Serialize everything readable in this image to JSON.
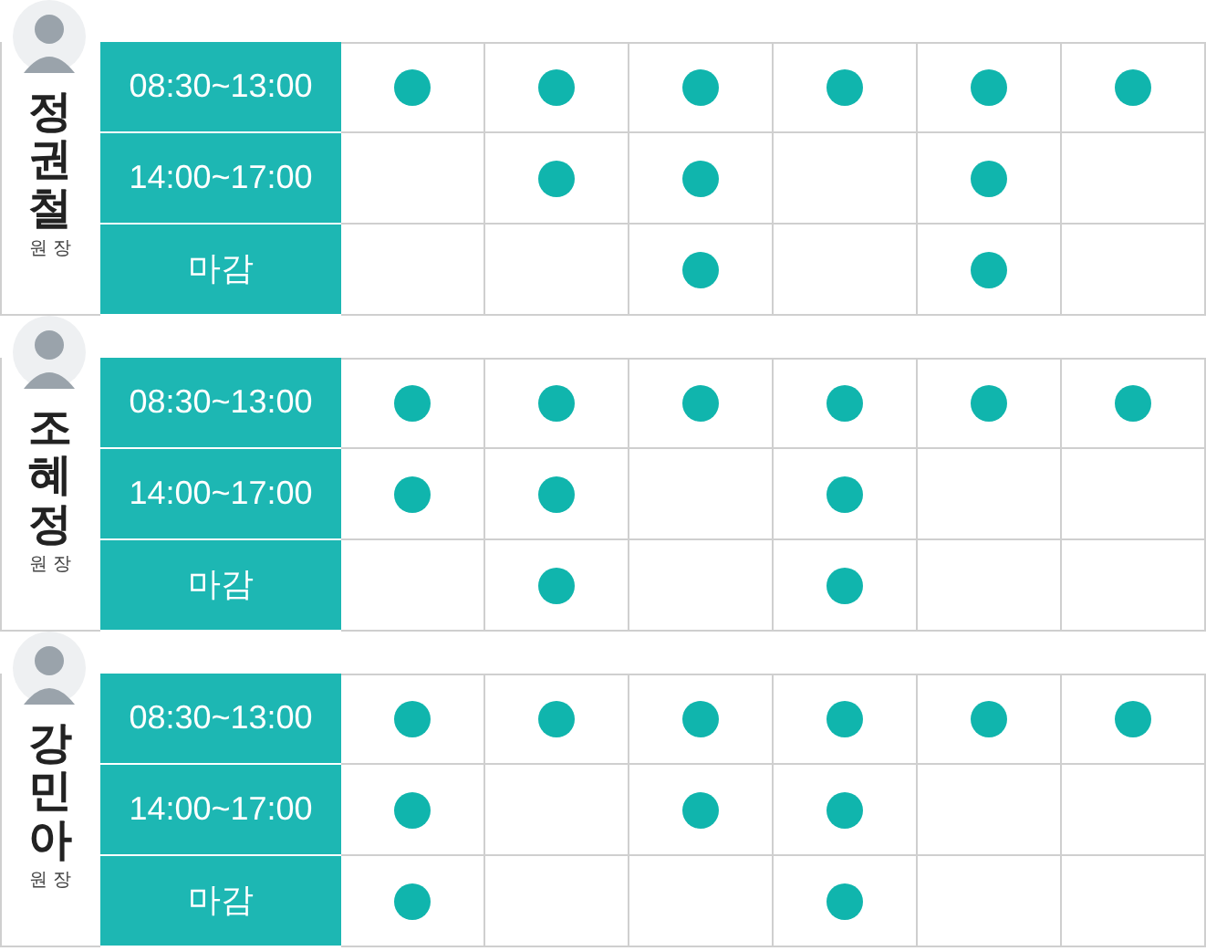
{
  "doctors": [
    {
      "name": "정권철",
      "title": "원장",
      "rows": [
        {
          "time": "08:30~13:00",
          "slots": [
            {
              "on": true
            },
            {
              "on": true
            },
            {
              "on": true
            },
            {
              "on": true
            },
            {
              "on": true
            },
            {
              "on": true
            }
          ]
        },
        {
          "time": "14:00~17:00",
          "slots": [
            {
              "on": false
            },
            {
              "on": true
            },
            {
              "on": true
            },
            {
              "on": false
            },
            {
              "on": true
            },
            {
              "on": false
            }
          ]
        },
        {
          "time": "마감",
          "slots": [
            {
              "on": false
            },
            {
              "on": false
            },
            {
              "on": true
            },
            {
              "on": false
            },
            {
              "on": true
            },
            {
              "on": false
            }
          ]
        }
      ]
    },
    {
      "name": "조혜정",
      "title": "원장",
      "rows": [
        {
          "time": "08:30~13:00",
          "slots": [
            {
              "on": true
            },
            {
              "on": true
            },
            {
              "on": true
            },
            {
              "on": true
            },
            {
              "on": true
            },
            {
              "on": true
            }
          ]
        },
        {
          "time": "14:00~17:00",
          "slots": [
            {
              "on": true
            },
            {
              "on": true
            },
            {
              "on": false
            },
            {
              "on": true
            },
            {
              "on": false
            },
            {
              "on": false
            }
          ]
        },
        {
          "time": "마감",
          "slots": [
            {
              "on": false
            },
            {
              "on": true
            },
            {
              "on": false
            },
            {
              "on": true
            },
            {
              "on": false
            },
            {
              "on": false
            }
          ]
        }
      ]
    },
    {
      "name": "강민아",
      "title": "원장",
      "rows": [
        {
          "time": "08:30~13:00",
          "slots": [
            {
              "on": true
            },
            {
              "on": true
            },
            {
              "on": true
            },
            {
              "on": true
            },
            {
              "on": true
            },
            {
              "on": true
            }
          ]
        },
        {
          "time": "14:00~17:00",
          "slots": [
            {
              "on": true
            },
            {
              "on": false
            },
            {
              "on": true
            },
            {
              "on": true
            },
            {
              "on": false
            },
            {
              "on": false
            }
          ]
        },
        {
          "time": "마감",
          "slots": [
            {
              "on": true
            },
            {
              "on": false
            },
            {
              "on": false
            },
            {
              "on": true
            },
            {
              "on": false
            },
            {
              "on": false
            }
          ]
        }
      ]
    }
  ]
}
